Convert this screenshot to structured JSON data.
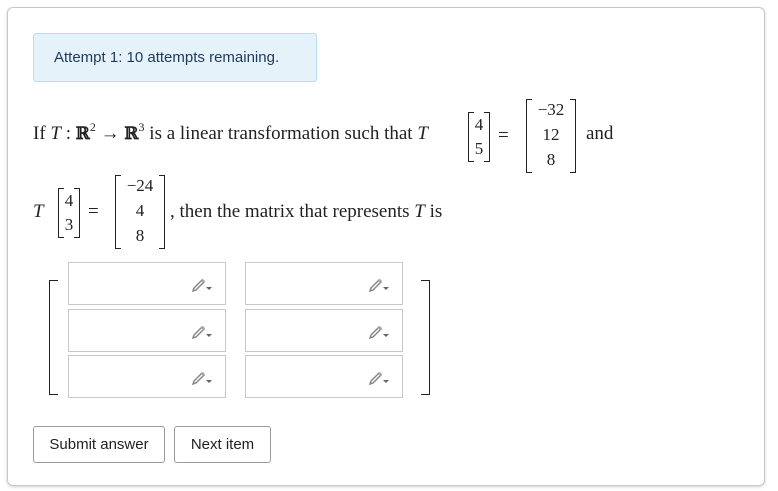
{
  "attempt_text": "Attempt 1: 10 attempts remaining.",
  "question": {
    "if_text": "If",
    "T": "T",
    "colon": ":",
    "R2": "ℝ",
    "exp2": "2",
    "arrow": "→",
    "R3": "ℝ",
    "exp3": "3",
    "middle_text": "is a linear transformation such that",
    "equals": "=",
    "and_text": "and",
    "then_text": ", then the matrix that represents",
    "is_text": "is",
    "v1_in": [
      "4",
      "5"
    ],
    "v1_out": [
      "−32",
      "12",
      "8"
    ],
    "v2_in": [
      "4",
      "3"
    ],
    "v2_out": [
      "−24",
      "4",
      "8"
    ]
  },
  "answer_matrix": {
    "rows": 3,
    "cols": 2,
    "values": [
      [
        "",
        ""
      ],
      [
        "",
        ""
      ],
      [
        "",
        ""
      ]
    ]
  },
  "buttons": {
    "submit_label": "Submit answer",
    "next_label": "Next item"
  },
  "icons": {
    "cell_icon": "pencil-dropdown-icon"
  }
}
